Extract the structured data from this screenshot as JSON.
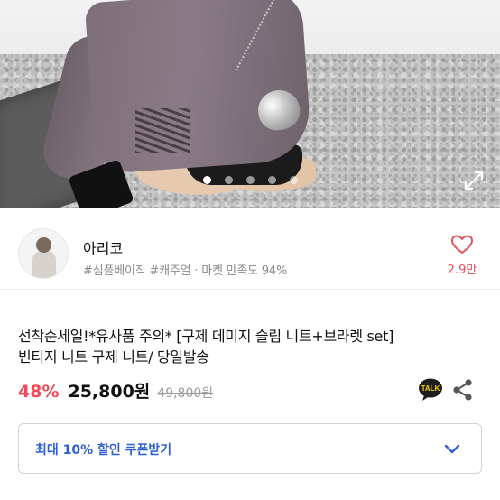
{
  "gallery": {
    "dot_count": 5,
    "active_index": 0
  },
  "shop": {
    "name": "아리코",
    "tags": "#심플베이직 #캐주얼 · 마켓 만족도 94%",
    "like_count": "2.9만"
  },
  "product": {
    "title_line1": "선착순세일!*유사품 주의* [구제 데미지 슬림 니트+브라렛 set]",
    "title_line2": "빈티지 니트 구제 니트/ 당일발송",
    "discount": "48%",
    "price": "25,800원",
    "original_price": "49,800원",
    "talk_label": "TALK"
  },
  "coupon": {
    "label": "최대 10% 할인 쿠폰받기"
  },
  "colors": {
    "accent_red": "#ef4a57",
    "heart": "#e8505b",
    "coupon_blue": "#2d5fd1",
    "talk_bg": "#1e1e1e"
  },
  "icons": {
    "expand": "expand-icon",
    "heart": "heart-icon",
    "talk": "kakao-talk-icon",
    "share": "share-icon",
    "chevron": "chevron-down-icon"
  }
}
